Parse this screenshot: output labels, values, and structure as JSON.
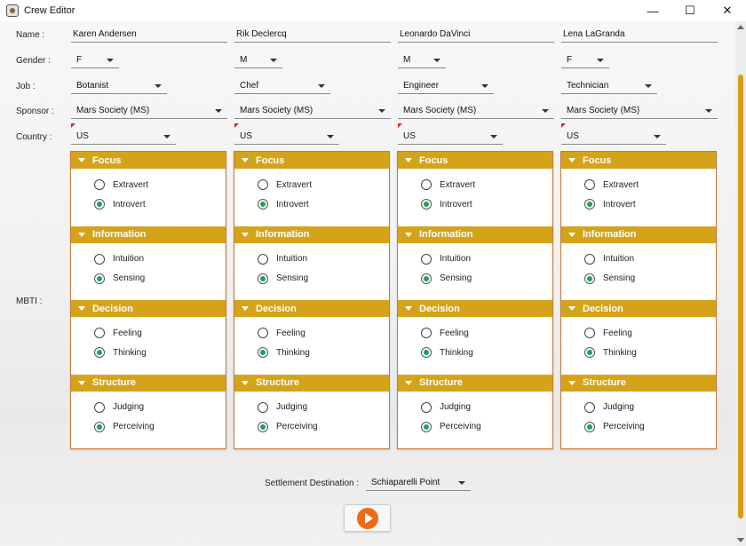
{
  "window": {
    "title": "Crew Editor",
    "minimize": "—",
    "maximize": "☐",
    "close": "✕"
  },
  "labels": {
    "name": "Name :",
    "gender": "Gender :",
    "job": "Job :",
    "sponsor": "Sponsor :",
    "country": "Country :",
    "mbti": "MBTI :"
  },
  "crew": [
    {
      "name": "Karen Andersen",
      "gender": "F",
      "job": "Botanist",
      "sponsor": "Mars Society (MS)",
      "country": "US",
      "mbti": {
        "focus": "Introvert",
        "information": "Sensing",
        "decision": "Thinking",
        "structure": "Perceiving"
      }
    },
    {
      "name": "Rik Declercq",
      "gender": "M",
      "job": "Chef",
      "sponsor": "Mars Society (MS)",
      "country": "US",
      "mbti": {
        "focus": "Introvert",
        "information": "Sensing",
        "decision": "Thinking",
        "structure": "Perceiving"
      }
    },
    {
      "name": "Leonardo DaVinci",
      "gender": "M",
      "job": "Engineer",
      "sponsor": "Mars Society (MS)",
      "country": "US",
      "mbti": {
        "focus": "Introvert",
        "information": "Sensing",
        "decision": "Thinking",
        "structure": "Perceiving"
      }
    },
    {
      "name": "Lena LaGranda",
      "gender": "F",
      "job": "Technician",
      "sponsor": "Mars Society (MS)",
      "country": "US",
      "mbti": {
        "focus": "Introvert",
        "information": "Sensing",
        "decision": "Thinking",
        "structure": "Perceiving"
      }
    }
  ],
  "mbti_sections": [
    {
      "title": "Focus",
      "options": [
        "Extravert",
        "Introvert"
      ]
    },
    {
      "title": "Information",
      "options": [
        "Intuition",
        "Sensing"
      ]
    },
    {
      "title": "Decision",
      "options": [
        "Feeling",
        "Thinking"
      ]
    },
    {
      "title": "Structure",
      "options": [
        "Judging",
        "Perceiving"
      ]
    }
  ],
  "settlement": {
    "label": "Settlement Destination :",
    "value": "Schiaparelli Point"
  },
  "colors": {
    "section_header": "#d4a31a",
    "radio_selected": "#1aa35a",
    "start_button": "#ef6a12",
    "card_border": "#c87a3a"
  },
  "icons": {
    "app": "app-icon",
    "start": "play-icon"
  }
}
